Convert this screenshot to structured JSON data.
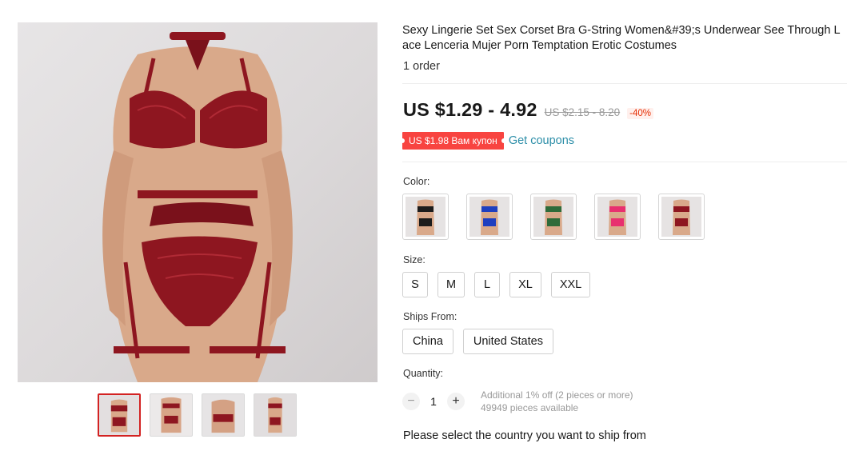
{
  "product": {
    "title": "Sexy Lingerie Set Sex Corset Bra G-String Women&#39;s Underwear See Through Lace Lenceria Mujer Porn Temptation Erotic Costumes",
    "orders": "1 order"
  },
  "price": {
    "current": "US $1.29 - 4.92",
    "original": "US $2.15 - 8.20",
    "discount": "-40%"
  },
  "coupon": {
    "badge": "US $1.98 Вам купон",
    "link": "Get coupons"
  },
  "color": {
    "label": "Color:",
    "swatches": [
      {
        "name": "black",
        "hex": "#1c1c1c"
      },
      {
        "name": "blue",
        "hex": "#1f3fbf"
      },
      {
        "name": "green",
        "hex": "#2f6b3a"
      },
      {
        "name": "pink",
        "hex": "#e8306f"
      },
      {
        "name": "red",
        "hex": "#8e1620"
      }
    ]
  },
  "size": {
    "label": "Size:",
    "options": [
      "S",
      "M",
      "L",
      "XL",
      "XXL"
    ]
  },
  "ships_from": {
    "label": "Ships From:",
    "options": [
      "China",
      "United States"
    ]
  },
  "quantity": {
    "label": "Quantity:",
    "minus": "−",
    "value": "1",
    "plus": "+",
    "discount_note": "Additional 1% off (2 pieces or more)",
    "available": "49949 pieces available"
  },
  "shipping_note": "Please select the country you want to ship from",
  "colors": {
    "garment": "#8e1620",
    "coupon": "#f84440",
    "link": "#2c8ea8",
    "active_thumb": "#d32222"
  }
}
